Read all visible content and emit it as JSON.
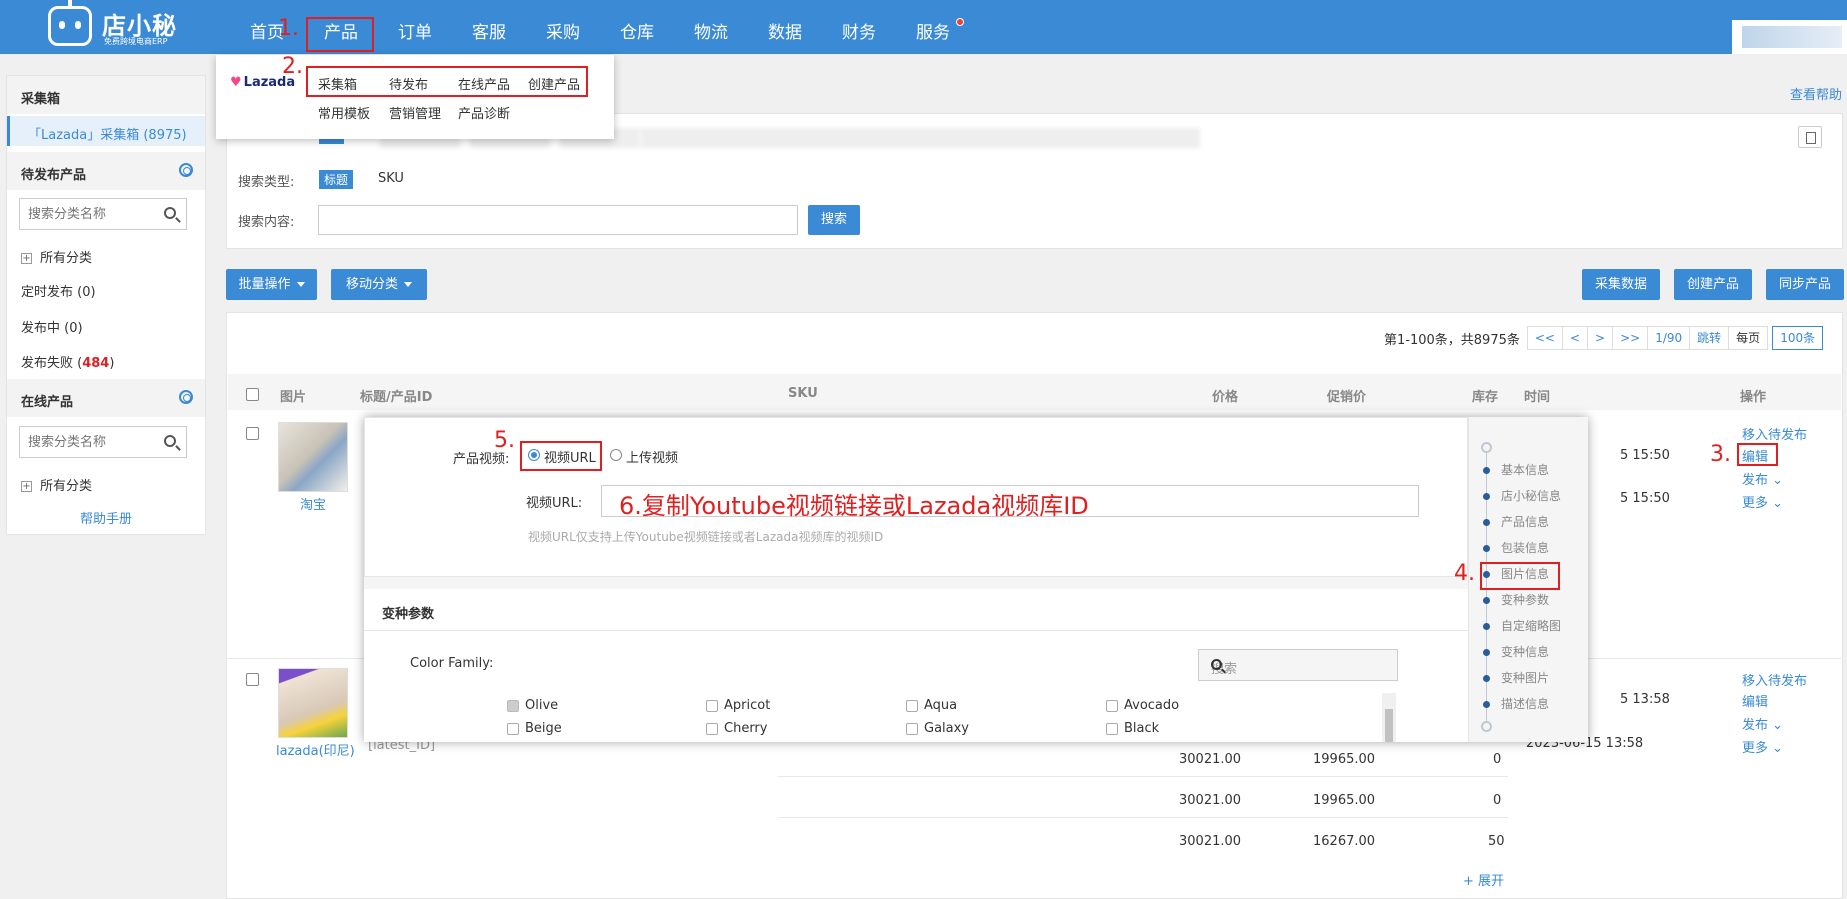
{
  "brand": {
    "name": "店小秘",
    "tagline": "免费跨境电商ERP"
  },
  "nav": [
    {
      "label": "首页"
    },
    {
      "label": "产品"
    },
    {
      "label": "订单"
    },
    {
      "label": "客服"
    },
    {
      "label": "采购"
    },
    {
      "label": "仓库"
    },
    {
      "label": "物流"
    },
    {
      "label": "数据"
    },
    {
      "label": "财务"
    },
    {
      "label": "服务"
    }
  ],
  "annotations": {
    "step1": "1.",
    "step2": "2.",
    "step3": "3.",
    "step4": "4.",
    "step5": "5.",
    "step6": "6.复制Youtube视频链接或Lazada视频库ID"
  },
  "dropdown": {
    "platform": "Lazada",
    "row1": [
      "采集箱",
      "待发布",
      "在线产品",
      "创建产品"
    ],
    "row2": [
      "常用模板",
      "营销管理",
      "产品诊断"
    ]
  },
  "sidebar": {
    "collect_title": "采集箱",
    "collect_selected": "「Lazada」采集箱 (8975)",
    "pending_title": "待发布产品",
    "search_placeholder": "搜索分类名称",
    "all_categories": "所有分类",
    "scheduled": "定时发布 (0)",
    "publishing": "发布中 (0)",
    "failed_label": "发布失败 (",
    "failed_count": "484",
    "failed_close": ")",
    "online_title": "在线产品",
    "help": "帮助手册"
  },
  "main": {
    "help_link": "查看帮助",
    "search_type_label": "搜索类型:",
    "search_type_active": "标题",
    "search_type_other": "SKU",
    "search_content_label": "搜索内容:",
    "search_button": "搜索",
    "batch_button": "批量操作",
    "move_button": "移动分类",
    "collect_data_button": "采集数据",
    "create_product_button": "创建产品",
    "sync_product_button": "同步产品"
  },
  "pager": {
    "summary": "第1-100条，共8975条",
    "first": "<<",
    "prev": "<",
    "next": ">",
    "last": ">>",
    "page": "1/90",
    "jump": "跳转",
    "per_page_label": "每页",
    "per_page": "100条"
  },
  "table": {
    "headers": {
      "image": "图片",
      "title": "标题/产品ID",
      "sku": "SKU",
      "price": "价格",
      "promo": "促销价",
      "stock": "库存",
      "time": "时间",
      "ops": "操作"
    },
    "row1": {
      "source": "淘宝",
      "time1": "5 15:50",
      "time2": "5 15:50"
    },
    "row2": {
      "source": "lazada(印尼)",
      "id_fragment": "[latest_ID]",
      "time1": "5 13:58",
      "time2": "2023-06-15 13:58",
      "sub_rows": [
        {
          "price": "30021.00",
          "promo": "19965.00",
          "stock": "0"
        },
        {
          "price": "30021.00",
          "promo": "19965.00",
          "stock": "0"
        },
        {
          "price": "30021.00",
          "promo": "16267.00",
          "stock": "50"
        }
      ],
      "expand": "+ 展开"
    },
    "ops": {
      "move": "移入待发布",
      "edit": "编辑",
      "publish": "发布",
      "more": "更多"
    }
  },
  "overlay": {
    "video_label": "产品视频:",
    "video_url_option": "视频URL",
    "upload_option": "上传视频",
    "url_label": "视频URL:",
    "hint": "视频URL仅支持上传Youtube视频链接或者Lazada视频库的视频ID",
    "variant_title": "变种参数",
    "color_family_label": "Color Family:",
    "search_placeholder": "搜索",
    "colors": [
      "Olive",
      "Apricot",
      "Aqua",
      "Avocado",
      "Beige",
      "Cherry",
      "Galaxy",
      "Black"
    ],
    "side_nav": [
      "基本信息",
      "店小秘信息",
      "产品信息",
      "包装信息",
      "图片信息",
      "变种参数",
      "自定缩略图",
      "变种信息",
      "变种图片",
      "描述信息"
    ]
  },
  "colors": {
    "primary": "#3a8ad6",
    "annotation": "#e02020"
  }
}
